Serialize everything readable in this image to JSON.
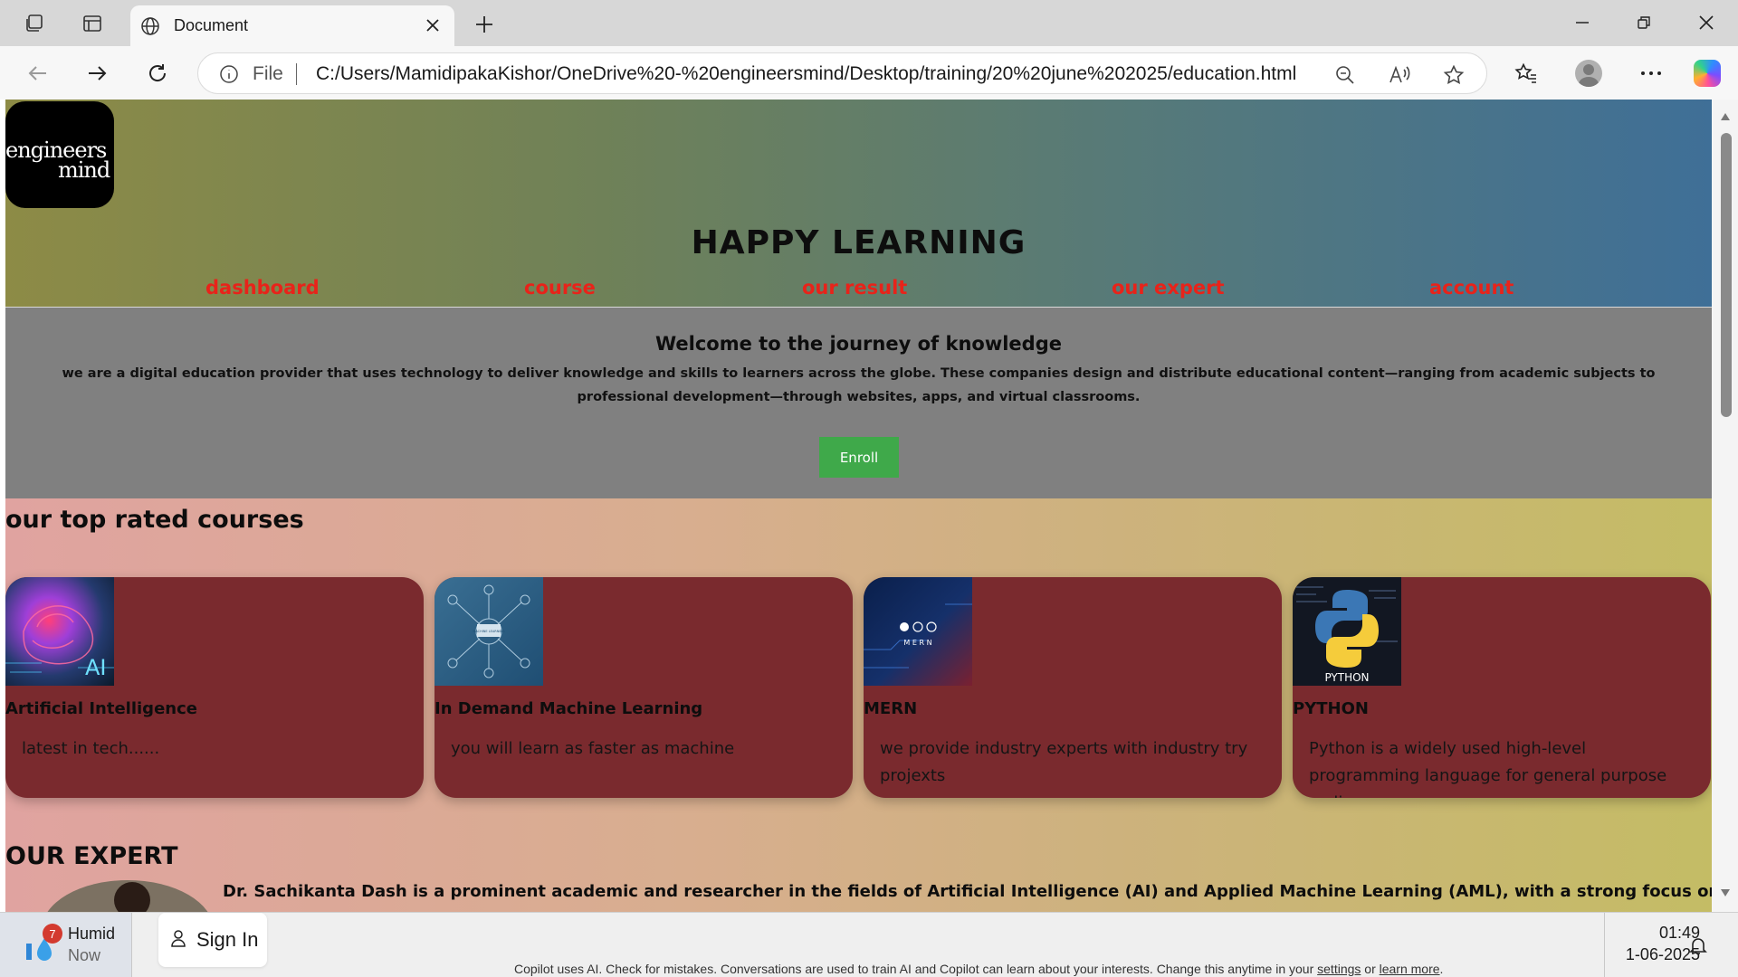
{
  "browser": {
    "tab_title": "Document",
    "address_prefix": "File",
    "url": "C:/Users/MamidipakaKishor/OneDrive%20-%20engineersmind/Desktop/training/20%20june%202025/education.html",
    "icons": [
      "workspaces-icon",
      "tab-actions-icon",
      "globe-icon",
      "close-icon",
      "new-tab-icon",
      "minimize-icon",
      "restore-icon",
      "window-close-icon",
      "back-icon",
      "forward-icon",
      "refresh-icon",
      "info-icon",
      "zoom-out-icon",
      "read-aloud-icon",
      "favorite-star-icon",
      "favorites-icon",
      "profile-icon",
      "more-icon",
      "copilot-icon"
    ]
  },
  "page": {
    "logo_line1": "engineers",
    "logo_line2": "mind",
    "title": "HAPPY LEARNING",
    "nav": [
      "dashboard",
      "course",
      "our result",
      "our expert",
      "account"
    ],
    "welcome_heading": "Welcome to the journey of knowledge",
    "welcome_text": "we are a digital education provider that uses technology to deliver knowledge and skills to learners across the globe. These companies design and distribute educational content—ranging from academic subjects to professional development—through websites, apps, and virtual classrooms.",
    "enroll_label": "Enroll",
    "courses_heading": "our top rated courses",
    "courses": [
      {
        "title": "Artificial Intelligence",
        "desc": "latest in tech......",
        "thumb_text": "AI"
      },
      {
        "title": "In Demand Machine Learning",
        "desc": "you will learn as faster as machine",
        "thumb_text": "MACHINE LEARNING"
      },
      {
        "title": "MERN",
        "desc": "we provide industry experts with industry try projexts",
        "thumb_text": "M E R N"
      },
      {
        "title": "PYTHON",
        "desc": "Python is a widely used high-level programming language for general purpose coding.",
        "thumb_text": "PYTHON"
      }
    ],
    "expert_heading": "OUR EXPERT",
    "expert_text": "Dr. Sachikanta Dash is a prominent academic and researcher in the fields of Artificial Intelligence (AI) and Applied Machine Learning (AML), with a strong focus on healthcare"
  },
  "taskbar": {
    "weather_badge": "7",
    "weather_label": "Humid",
    "weather_sub": "Now",
    "signin_label": "Sign In",
    "copilot_note": "Copilot uses AI. Check for mistakes. Conversations are used to train AI and Copilot can learn about your interests. Change this anytime in your",
    "copilot_settings": "settings",
    "copilot_or": "or",
    "copilot_learn": "learn more",
    "time": "01:49",
    "date": "1-06-2025"
  },
  "colors": {
    "nav_link": "#e8231a",
    "card_bg": "#7a2a2e",
    "enroll_bg": "#3fa94a",
    "welcome_bg": "#808080"
  }
}
